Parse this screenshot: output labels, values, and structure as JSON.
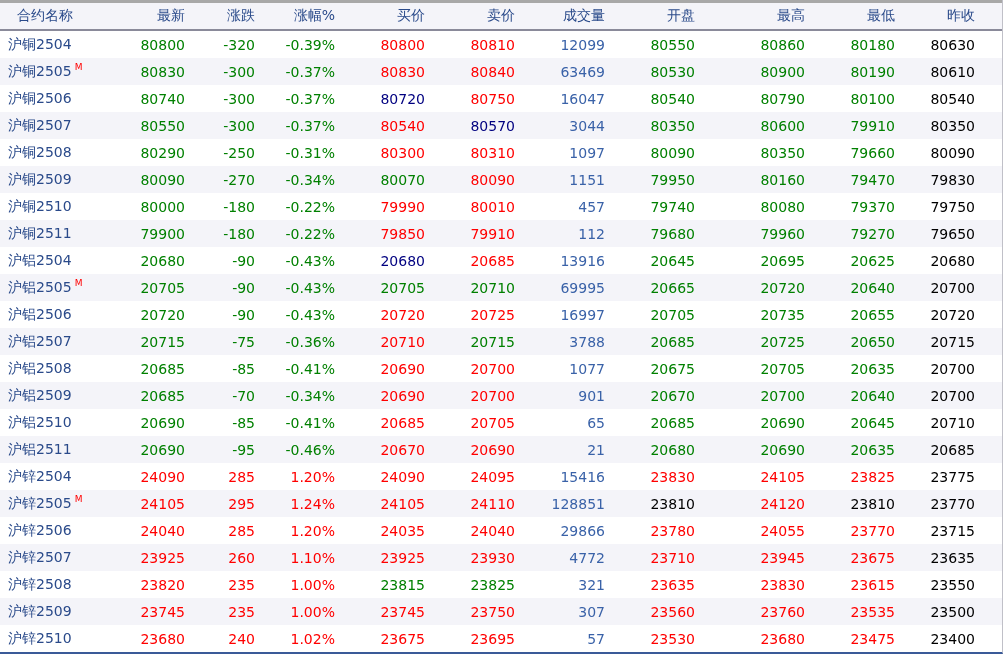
{
  "table": {
    "columns": [
      "合约名称",
      "最新",
      "涨跌",
      "涨幅%",
      "买价",
      "卖价",
      "成交量",
      "开盘",
      "最高",
      "最低",
      "昨收"
    ],
    "rows": [
      {
        "cells": [
          {
            "text": "沪铜2504"
          },
          {
            "text": "80800",
            "color": "#008000"
          },
          {
            "text": "-320",
            "color": "#008000"
          },
          {
            "text": "-0.39%",
            "color": "#008000"
          },
          {
            "text": "80800",
            "color": "#ff0000"
          },
          {
            "text": "80810",
            "color": "#ff0000"
          },
          {
            "text": "12099",
            "color": "#3a62a8"
          },
          {
            "text": "80550",
            "color": "#008000"
          },
          {
            "text": "80860",
            "color": "#008000"
          },
          {
            "text": "80180",
            "color": "#008000"
          },
          {
            "text": "80630",
            "color": "#000000"
          }
        ]
      },
      {
        "cells": [
          {
            "text": "沪铜2505",
            "badge": "M"
          },
          {
            "text": "80830",
            "color": "#008000"
          },
          {
            "text": "-300",
            "color": "#008000"
          },
          {
            "text": "-0.37%",
            "color": "#008000"
          },
          {
            "text": "80830",
            "color": "#ff0000"
          },
          {
            "text": "80840",
            "color": "#ff0000"
          },
          {
            "text": "63469",
            "color": "#3a62a8"
          },
          {
            "text": "80530",
            "color": "#008000"
          },
          {
            "text": "80900",
            "color": "#008000"
          },
          {
            "text": "80190",
            "color": "#008000"
          },
          {
            "text": "80610",
            "color": "#000000"
          }
        ]
      },
      {
        "cells": [
          {
            "text": "沪铜2506"
          },
          {
            "text": "80740",
            "color": "#008000"
          },
          {
            "text": "-300",
            "color": "#008000"
          },
          {
            "text": "-0.37%",
            "color": "#008000"
          },
          {
            "text": "80720",
            "color": "#000080"
          },
          {
            "text": "80750",
            "color": "#ff0000"
          },
          {
            "text": "16047",
            "color": "#3a62a8"
          },
          {
            "text": "80540",
            "color": "#008000"
          },
          {
            "text": "80790",
            "color": "#008000"
          },
          {
            "text": "80100",
            "color": "#008000"
          },
          {
            "text": "80540",
            "color": "#000000"
          }
        ]
      },
      {
        "cells": [
          {
            "text": "沪铜2507"
          },
          {
            "text": "80550",
            "color": "#008000"
          },
          {
            "text": "-300",
            "color": "#008000"
          },
          {
            "text": "-0.37%",
            "color": "#008000"
          },
          {
            "text": "80540",
            "color": "#ff0000"
          },
          {
            "text": "80570",
            "color": "#000080"
          },
          {
            "text": "3044",
            "color": "#3a62a8"
          },
          {
            "text": "80350",
            "color": "#008000"
          },
          {
            "text": "80600",
            "color": "#008000"
          },
          {
            "text": "79910",
            "color": "#008000"
          },
          {
            "text": "80350",
            "color": "#000000"
          }
        ]
      },
      {
        "cells": [
          {
            "text": "沪铜2508"
          },
          {
            "text": "80290",
            "color": "#008000"
          },
          {
            "text": "-250",
            "color": "#008000"
          },
          {
            "text": "-0.31%",
            "color": "#008000"
          },
          {
            "text": "80300",
            "color": "#ff0000"
          },
          {
            "text": "80310",
            "color": "#ff0000"
          },
          {
            "text": "1097",
            "color": "#3a62a8"
          },
          {
            "text": "80090",
            "color": "#008000"
          },
          {
            "text": "80350",
            "color": "#008000"
          },
          {
            "text": "79660",
            "color": "#008000"
          },
          {
            "text": "80090",
            "color": "#000000"
          }
        ]
      },
      {
        "cells": [
          {
            "text": "沪铜2509"
          },
          {
            "text": "80090",
            "color": "#008000"
          },
          {
            "text": "-270",
            "color": "#008000"
          },
          {
            "text": "-0.34%",
            "color": "#008000"
          },
          {
            "text": "80070",
            "color": "#008000"
          },
          {
            "text": "80090",
            "color": "#ff0000"
          },
          {
            "text": "1151",
            "color": "#3a62a8"
          },
          {
            "text": "79950",
            "color": "#008000"
          },
          {
            "text": "80160",
            "color": "#008000"
          },
          {
            "text": "79470",
            "color": "#008000"
          },
          {
            "text": "79830",
            "color": "#000000"
          }
        ]
      },
      {
        "cells": [
          {
            "text": "沪铜2510"
          },
          {
            "text": "80000",
            "color": "#008000"
          },
          {
            "text": "-180",
            "color": "#008000"
          },
          {
            "text": "-0.22%",
            "color": "#008000"
          },
          {
            "text": "79990",
            "color": "#ff0000"
          },
          {
            "text": "80010",
            "color": "#ff0000"
          },
          {
            "text": "457",
            "color": "#3a62a8"
          },
          {
            "text": "79740",
            "color": "#008000"
          },
          {
            "text": "80080",
            "color": "#008000"
          },
          {
            "text": "79370",
            "color": "#008000"
          },
          {
            "text": "79750",
            "color": "#000000"
          }
        ]
      },
      {
        "cells": [
          {
            "text": "沪铜2511"
          },
          {
            "text": "79900",
            "color": "#008000"
          },
          {
            "text": "-180",
            "color": "#008000"
          },
          {
            "text": "-0.22%",
            "color": "#008000"
          },
          {
            "text": "79850",
            "color": "#ff0000"
          },
          {
            "text": "79910",
            "color": "#ff0000"
          },
          {
            "text": "112",
            "color": "#3a62a8"
          },
          {
            "text": "79680",
            "color": "#008000"
          },
          {
            "text": "79960",
            "color": "#008000"
          },
          {
            "text": "79270",
            "color": "#008000"
          },
          {
            "text": "79650",
            "color": "#000000"
          }
        ]
      },
      {
        "cells": [
          {
            "text": "沪铝2504"
          },
          {
            "text": "20680",
            "color": "#008000"
          },
          {
            "text": "-90",
            "color": "#008000"
          },
          {
            "text": "-0.43%",
            "color": "#008000"
          },
          {
            "text": "20680",
            "color": "#000080"
          },
          {
            "text": "20685",
            "color": "#ff0000"
          },
          {
            "text": "13916",
            "color": "#3a62a8"
          },
          {
            "text": "20645",
            "color": "#008000"
          },
          {
            "text": "20695",
            "color": "#008000"
          },
          {
            "text": "20625",
            "color": "#008000"
          },
          {
            "text": "20680",
            "color": "#000000"
          }
        ]
      },
      {
        "cells": [
          {
            "text": "沪铝2505",
            "badge": "M"
          },
          {
            "text": "20705",
            "color": "#008000"
          },
          {
            "text": "-90",
            "color": "#008000"
          },
          {
            "text": "-0.43%",
            "color": "#008000"
          },
          {
            "text": "20705",
            "color": "#008000"
          },
          {
            "text": "20710",
            "color": "#008000"
          },
          {
            "text": "69995",
            "color": "#3a62a8"
          },
          {
            "text": "20665",
            "color": "#008000"
          },
          {
            "text": "20720",
            "color": "#008000"
          },
          {
            "text": "20640",
            "color": "#008000"
          },
          {
            "text": "20700",
            "color": "#000000"
          }
        ]
      },
      {
        "cells": [
          {
            "text": "沪铝2506"
          },
          {
            "text": "20720",
            "color": "#008000"
          },
          {
            "text": "-90",
            "color": "#008000"
          },
          {
            "text": "-0.43%",
            "color": "#008000"
          },
          {
            "text": "20720",
            "color": "#ff0000"
          },
          {
            "text": "20725",
            "color": "#ff0000"
          },
          {
            "text": "16997",
            "color": "#3a62a8"
          },
          {
            "text": "20705",
            "color": "#008000"
          },
          {
            "text": "20735",
            "color": "#008000"
          },
          {
            "text": "20655",
            "color": "#008000"
          },
          {
            "text": "20720",
            "color": "#000000"
          }
        ]
      },
      {
        "cells": [
          {
            "text": "沪铝2507"
          },
          {
            "text": "20715",
            "color": "#008000"
          },
          {
            "text": "-75",
            "color": "#008000"
          },
          {
            "text": "-0.36%",
            "color": "#008000"
          },
          {
            "text": "20710",
            "color": "#ff0000"
          },
          {
            "text": "20715",
            "color": "#008000"
          },
          {
            "text": "3788",
            "color": "#3a62a8"
          },
          {
            "text": "20685",
            "color": "#008000"
          },
          {
            "text": "20725",
            "color": "#008000"
          },
          {
            "text": "20650",
            "color": "#008000"
          },
          {
            "text": "20715",
            "color": "#000000"
          }
        ]
      },
      {
        "cells": [
          {
            "text": "沪铝2508"
          },
          {
            "text": "20685",
            "color": "#008000"
          },
          {
            "text": "-85",
            "color": "#008000"
          },
          {
            "text": "-0.41%",
            "color": "#008000"
          },
          {
            "text": "20690",
            "color": "#ff0000"
          },
          {
            "text": "20700",
            "color": "#ff0000"
          },
          {
            "text": "1077",
            "color": "#3a62a8"
          },
          {
            "text": "20675",
            "color": "#008000"
          },
          {
            "text": "20705",
            "color": "#008000"
          },
          {
            "text": "20635",
            "color": "#008000"
          },
          {
            "text": "20700",
            "color": "#000000"
          }
        ]
      },
      {
        "cells": [
          {
            "text": "沪铝2509"
          },
          {
            "text": "20685",
            "color": "#008000"
          },
          {
            "text": "-70",
            "color": "#008000"
          },
          {
            "text": "-0.34%",
            "color": "#008000"
          },
          {
            "text": "20690",
            "color": "#ff0000"
          },
          {
            "text": "20700",
            "color": "#ff0000"
          },
          {
            "text": "901",
            "color": "#3a62a8"
          },
          {
            "text": "20670",
            "color": "#008000"
          },
          {
            "text": "20700",
            "color": "#008000"
          },
          {
            "text": "20640",
            "color": "#008000"
          },
          {
            "text": "20700",
            "color": "#000000"
          }
        ]
      },
      {
        "cells": [
          {
            "text": "沪铝2510"
          },
          {
            "text": "20690",
            "color": "#008000"
          },
          {
            "text": "-85",
            "color": "#008000"
          },
          {
            "text": "-0.41%",
            "color": "#008000"
          },
          {
            "text": "20685",
            "color": "#ff0000"
          },
          {
            "text": "20705",
            "color": "#ff0000"
          },
          {
            "text": "65",
            "color": "#3a62a8"
          },
          {
            "text": "20685",
            "color": "#008000"
          },
          {
            "text": "20690",
            "color": "#008000"
          },
          {
            "text": "20645",
            "color": "#008000"
          },
          {
            "text": "20710",
            "color": "#000000"
          }
        ]
      },
      {
        "cells": [
          {
            "text": "沪铝2511"
          },
          {
            "text": "20690",
            "color": "#008000"
          },
          {
            "text": "-95",
            "color": "#008000"
          },
          {
            "text": "-0.46%",
            "color": "#008000"
          },
          {
            "text": "20670",
            "color": "#ff0000"
          },
          {
            "text": "20690",
            "color": "#ff0000"
          },
          {
            "text": "21",
            "color": "#3a62a8"
          },
          {
            "text": "20680",
            "color": "#008000"
          },
          {
            "text": "20690",
            "color": "#008000"
          },
          {
            "text": "20635",
            "color": "#008000"
          },
          {
            "text": "20685",
            "color": "#000000"
          }
        ]
      },
      {
        "cells": [
          {
            "text": "沪锌2504"
          },
          {
            "text": "24090",
            "color": "#ff0000"
          },
          {
            "text": "285",
            "color": "#ff0000"
          },
          {
            "text": "1.20%",
            "color": "#ff0000"
          },
          {
            "text": "24090",
            "color": "#ff0000"
          },
          {
            "text": "24095",
            "color": "#ff0000"
          },
          {
            "text": "15416",
            "color": "#3a62a8"
          },
          {
            "text": "23830",
            "color": "#ff0000"
          },
          {
            "text": "24105",
            "color": "#ff0000"
          },
          {
            "text": "23825",
            "color": "#ff0000"
          },
          {
            "text": "23775",
            "color": "#000000"
          }
        ]
      },
      {
        "cells": [
          {
            "text": "沪锌2505",
            "badge": "M"
          },
          {
            "text": "24105",
            "color": "#ff0000"
          },
          {
            "text": "295",
            "color": "#ff0000"
          },
          {
            "text": "1.24%",
            "color": "#ff0000"
          },
          {
            "text": "24105",
            "color": "#ff0000"
          },
          {
            "text": "24110",
            "color": "#ff0000"
          },
          {
            "text": "128851",
            "color": "#3a62a8"
          },
          {
            "text": "23810",
            "color": "#000000"
          },
          {
            "text": "24120",
            "color": "#ff0000"
          },
          {
            "text": "23810",
            "color": "#000000"
          },
          {
            "text": "23770",
            "color": "#000000"
          }
        ]
      },
      {
        "cells": [
          {
            "text": "沪锌2506"
          },
          {
            "text": "24040",
            "color": "#ff0000"
          },
          {
            "text": "285",
            "color": "#ff0000"
          },
          {
            "text": "1.20%",
            "color": "#ff0000"
          },
          {
            "text": "24035",
            "color": "#ff0000"
          },
          {
            "text": "24040",
            "color": "#ff0000"
          },
          {
            "text": "29866",
            "color": "#3a62a8"
          },
          {
            "text": "23780",
            "color": "#ff0000"
          },
          {
            "text": "24055",
            "color": "#ff0000"
          },
          {
            "text": "23770",
            "color": "#ff0000"
          },
          {
            "text": "23715",
            "color": "#000000"
          }
        ]
      },
      {
        "cells": [
          {
            "text": "沪锌2507"
          },
          {
            "text": "23925",
            "color": "#ff0000"
          },
          {
            "text": "260",
            "color": "#ff0000"
          },
          {
            "text": "1.10%",
            "color": "#ff0000"
          },
          {
            "text": "23925",
            "color": "#ff0000"
          },
          {
            "text": "23930",
            "color": "#ff0000"
          },
          {
            "text": "4772",
            "color": "#3a62a8"
          },
          {
            "text": "23710",
            "color": "#ff0000"
          },
          {
            "text": "23945",
            "color": "#ff0000"
          },
          {
            "text": "23675",
            "color": "#ff0000"
          },
          {
            "text": "23635",
            "color": "#000000"
          }
        ]
      },
      {
        "cells": [
          {
            "text": "沪锌2508"
          },
          {
            "text": "23820",
            "color": "#ff0000"
          },
          {
            "text": "235",
            "color": "#ff0000"
          },
          {
            "text": "1.00%",
            "color": "#ff0000"
          },
          {
            "text": "23815",
            "color": "#008000"
          },
          {
            "text": "23825",
            "color": "#008000"
          },
          {
            "text": "321",
            "color": "#3a62a8"
          },
          {
            "text": "23635",
            "color": "#ff0000"
          },
          {
            "text": "23830",
            "color": "#ff0000"
          },
          {
            "text": "23615",
            "color": "#ff0000"
          },
          {
            "text": "23550",
            "color": "#000000"
          }
        ]
      },
      {
        "cells": [
          {
            "text": "沪锌2509"
          },
          {
            "text": "23745",
            "color": "#ff0000"
          },
          {
            "text": "235",
            "color": "#ff0000"
          },
          {
            "text": "1.00%",
            "color": "#ff0000"
          },
          {
            "text": "23745",
            "color": "#ff0000"
          },
          {
            "text": "23750",
            "color": "#ff0000"
          },
          {
            "text": "307",
            "color": "#3a62a8"
          },
          {
            "text": "23560",
            "color": "#ff0000"
          },
          {
            "text": "23760",
            "color": "#ff0000"
          },
          {
            "text": "23535",
            "color": "#ff0000"
          },
          {
            "text": "23500",
            "color": "#000000"
          }
        ]
      },
      {
        "cells": [
          {
            "text": "沪锌2510"
          },
          {
            "text": "23680",
            "color": "#ff0000"
          },
          {
            "text": "240",
            "color": "#ff0000"
          },
          {
            "text": "1.02%",
            "color": "#ff0000"
          },
          {
            "text": "23675",
            "color": "#ff0000"
          },
          {
            "text": "23695",
            "color": "#ff0000"
          },
          {
            "text": "57",
            "color": "#3a62a8"
          },
          {
            "text": "23530",
            "color": "#ff0000"
          },
          {
            "text": "23680",
            "color": "#ff0000"
          },
          {
            "text": "23475",
            "color": "#ff0000"
          },
          {
            "text": "23400",
            "color": "#000000"
          }
        ]
      }
    ]
  }
}
